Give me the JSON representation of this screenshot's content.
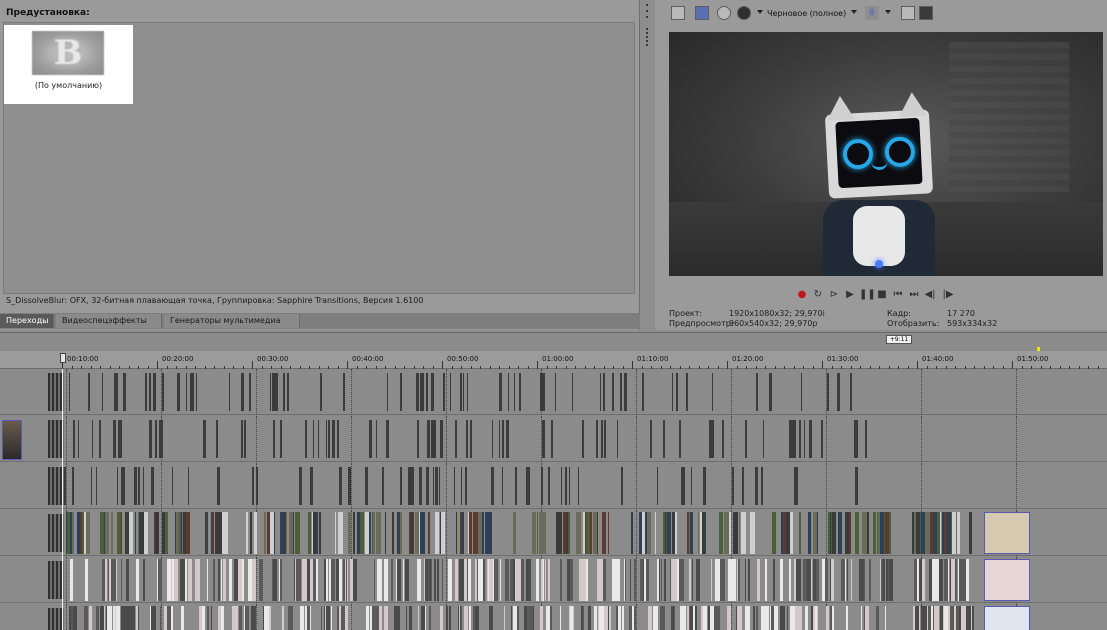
{
  "presets": {
    "header": "Предустановка:",
    "items": [
      {
        "label": "(По умолчанию)",
        "thumb_glyph": "B"
      }
    ]
  },
  "status": {
    "text": "S_DissolveBlur: OFX, 32-битная плавающая точка, Группировка: Sapphire Transitions, Версия 1.6100"
  },
  "window_tabs": [
    {
      "label": "Переходы",
      "active": true
    },
    {
      "label": "Видеоспецэффекты",
      "active": false
    },
    {
      "label": "Генераторы мультимедиа",
      "active": false
    }
  ],
  "preview": {
    "toolbar": {
      "quality": "Черновое (полное)"
    },
    "transport_icons": [
      "record-icon",
      "loop-icon",
      "play-from-start-icon",
      "play-icon",
      "pause-icon",
      "stop-icon",
      "prev-marker-icon",
      "next-marker-icon",
      "prev-frame-icon",
      "next-frame-icon"
    ],
    "info": {
      "project_label": "Проект:",
      "project_value": "1920x1080x32; 29,970i",
      "preview_label": "Предпросмотр:",
      "preview_value": "960x540x32; 29,970p",
      "frame_label": "Кадр:",
      "frame_value": "17 270",
      "display_label": "Отобразить:",
      "display_value": "593x334x32"
    }
  },
  "timeline": {
    "timecode_badge": "+9:11",
    "ruler_labels": [
      "00:10:00",
      "00:20:00",
      "00:30:00",
      "00:40:00",
      "00:50:00",
      "01:00:00",
      "01:10:00",
      "01:20:00",
      "01:30:00",
      "01:40:00",
      "01:50:00"
    ],
    "tracks": [
      {
        "kind": "video-sparse"
      },
      {
        "kind": "video-sparse"
      },
      {
        "kind": "video-sparse"
      },
      {
        "kind": "video-main"
      },
      {
        "kind": "audio"
      },
      {
        "kind": "audio"
      }
    ]
  },
  "colors": {
    "background": "#8e8e8e",
    "accent_blue": "#27a7e8",
    "record_red": "#c01818",
    "end_marker": "#e8e800"
  }
}
